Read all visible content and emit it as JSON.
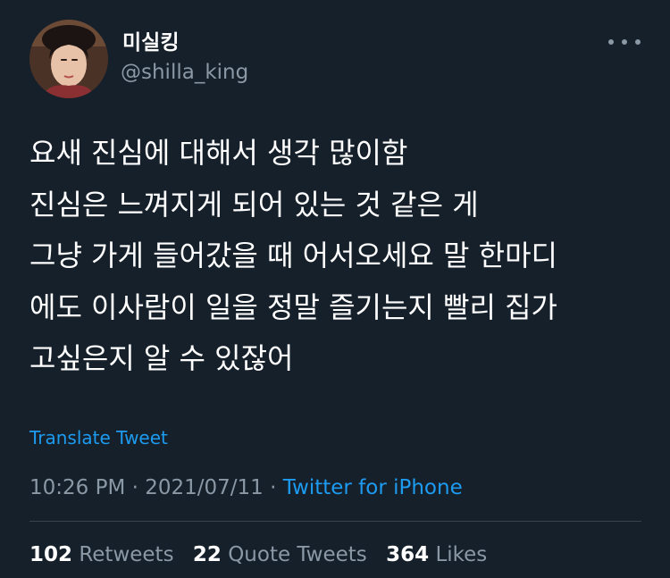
{
  "author": {
    "display_name": "미실킹",
    "handle": "@shilla_king"
  },
  "tweet": {
    "lines": [
      "요새 진심에 대해서 생각 많이함",
      "진심은 느껴지게 되어 있는 것 같은 게",
      "그냥 가게 들어갔을 때 어서오세요 말 한마디",
      "에도 이사람이 일을 정말 즐기는지 빨리 집가",
      "고싶은지 알 수 있잖어"
    ],
    "translate_label": "Translate Tweet"
  },
  "meta": {
    "time": "10:26 PM",
    "separator": " · ",
    "date": "2021/07/11",
    "source": "Twitter for iPhone"
  },
  "stats": {
    "retweets_count": "102",
    "retweets_label": "Retweets",
    "quote_count": "22",
    "quote_label": "Quote Tweets",
    "likes_count": "364",
    "likes_label": "Likes"
  },
  "icons": {
    "more": "more-horizontal-icon"
  },
  "colors": {
    "background": "#15202b",
    "text": "#ffffff",
    "muted": "#8b98a5",
    "accent": "#1d9bf0",
    "divider": "#38444d"
  }
}
